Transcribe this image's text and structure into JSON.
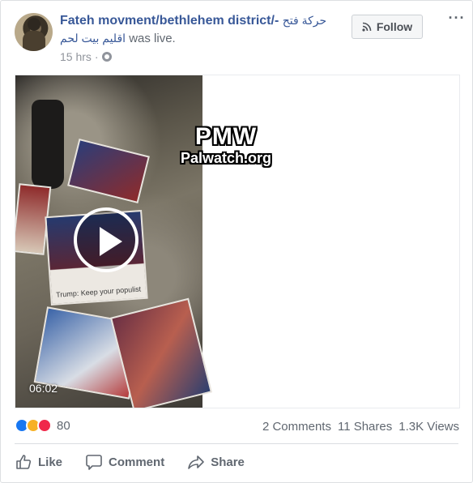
{
  "post": {
    "page_name": "Fateh movment/bethlehem district/-",
    "page_name_arabic": "حركة فتح",
    "live_arabic": "اقليم بيت لحم",
    "live_suffix": "was live.",
    "time": "15 hrs",
    "time_separator": "·",
    "privacy_icon": "globe-icon"
  },
  "header": {
    "follow_label": "Follow",
    "follow_icon": "rss-icon",
    "more_label": "···"
  },
  "video": {
    "watermark_big": "PMW",
    "watermark_small": "Palwatch.org",
    "poster_caption": "Trump: Keep your populist",
    "duration": "06:02",
    "play_icon": "play-icon"
  },
  "stats": {
    "reaction_icons": [
      "like-reaction-icon",
      "sad-reaction-icon",
      "love-reaction-icon"
    ],
    "reaction_count": "80",
    "comments": "2 Comments",
    "shares": "11 Shares",
    "views": "1.3K Views"
  },
  "actions": {
    "like_label": "Like",
    "comment_label": "Comment",
    "share_label": "Share"
  },
  "colors": {
    "link": "#385898",
    "secondary_text": "#606770",
    "like_blue": "#1877f2",
    "sad_yellow": "#f7b125",
    "love_red": "#f0284a"
  }
}
